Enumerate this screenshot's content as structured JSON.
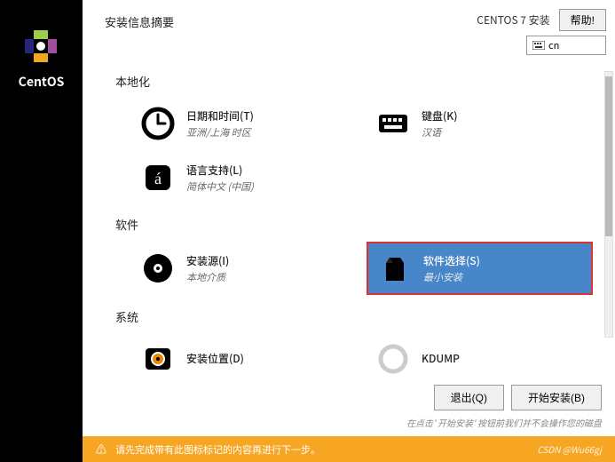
{
  "sidebar": {
    "product": "CentOS"
  },
  "header": {
    "title": "安装信息摘要",
    "os": "CENTOS 7 安装",
    "help": "帮助!",
    "lang_code": "cn"
  },
  "sections": {
    "localization": {
      "title": "本地化",
      "datetime": {
        "title": "日期和时间(T)",
        "sub": "亚洲/上海 时区"
      },
      "keyboard": {
        "title": "键盘(K)",
        "sub": "汉语"
      },
      "language": {
        "title": "语言支持(L)",
        "sub": "简体中文 (中国)"
      }
    },
    "software": {
      "title": "软件",
      "source": {
        "title": "安装源(I)",
        "sub": "本地介质"
      },
      "selection": {
        "title": "软件选择(S)",
        "sub": "最小安装"
      }
    },
    "system": {
      "title": "系统",
      "destination": {
        "title": "安装位置(D)",
        "sub": ""
      },
      "kdump": {
        "title": "KDUMP",
        "sub": ""
      }
    }
  },
  "footer": {
    "quit": "退出(Q)",
    "begin": "开始安装(B)",
    "hint": "在点击' 开始安装' 按钮前我们并不会操作您的磁盘"
  },
  "warning": {
    "text": "请先完成带有此图标标记的内容再进行下一步。",
    "watermark": "CSDN @Wu66gj"
  }
}
